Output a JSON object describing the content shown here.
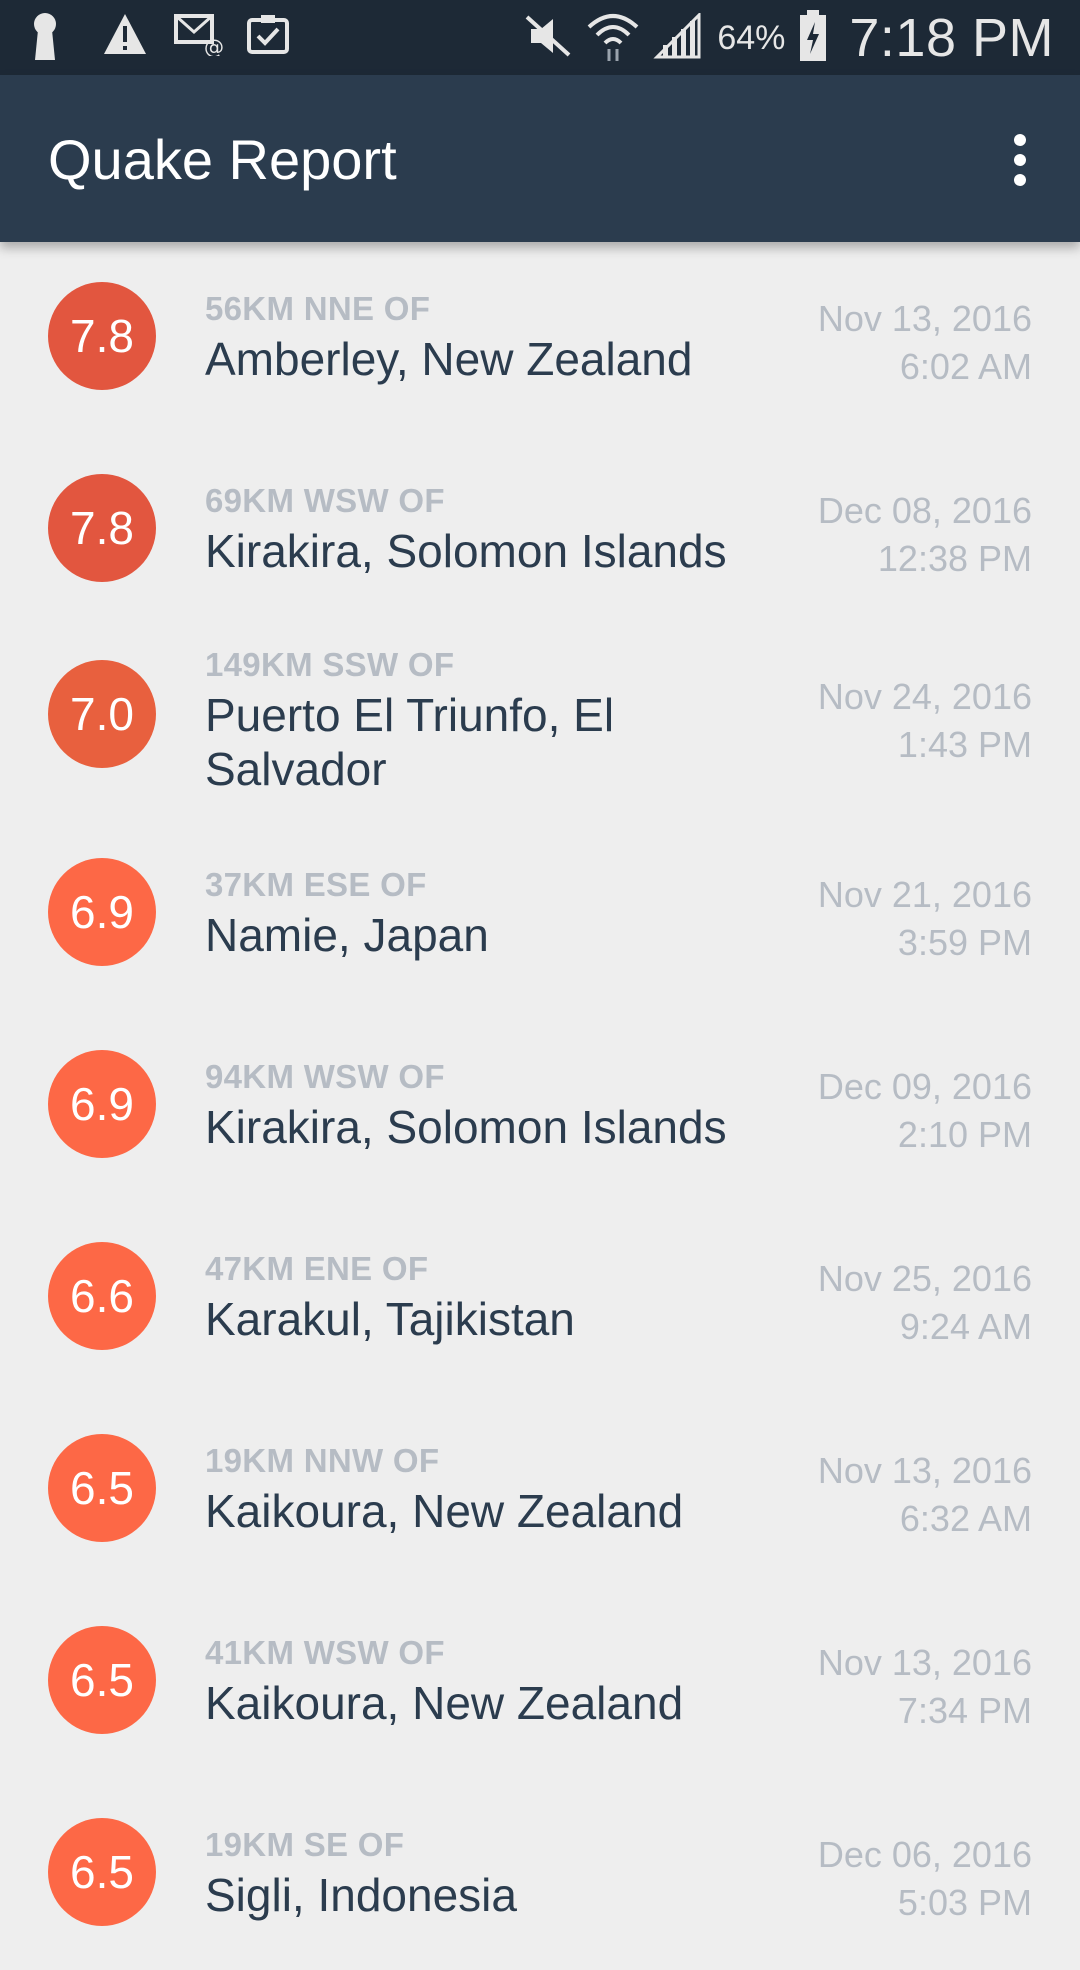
{
  "status_bar": {
    "icons_left": [
      "keyhole-icon",
      "warning-icon",
      "email-icon",
      "clipboard-check-icon"
    ],
    "icons_right": [
      "mute-icon",
      "wifi-icon",
      "signal-icon",
      "battery-charging-icon"
    ],
    "battery": "64%",
    "time": "7:18 PM"
  },
  "app_bar": {
    "title": "Quake Report",
    "menu_icon": "overflow-menu-icon"
  },
  "earthquakes": [
    {
      "mag": "7.8",
      "offset": "56KM NNE OF",
      "location": "Amberley, New Zealand",
      "date": "Nov 13, 2016",
      "time": "6:02 AM",
      "color": "#e2563f"
    },
    {
      "mag": "7.8",
      "offset": "69KM WSW OF",
      "location": "Kirakira, Solomon Islands",
      "date": "Dec 08, 2016",
      "time": "12:38 PM",
      "color": "#e2563f"
    },
    {
      "mag": "7.0",
      "offset": "149KM SSW OF",
      "location": "Puerto El Triunfo, El Salvador",
      "date": "Nov 24, 2016",
      "time": "1:43 PM",
      "color": "#e8603e"
    },
    {
      "mag": "6.9",
      "offset": "37KM ESE OF",
      "location": "Namie, Japan",
      "date": "Nov 21, 2016",
      "time": "3:59 PM",
      "color": "#fd6846"
    },
    {
      "mag": "6.9",
      "offset": "94KM WSW OF",
      "location": "Kirakira, Solomon Islands",
      "date": "Dec 09, 2016",
      "time": "2:10 PM",
      "color": "#fd6846"
    },
    {
      "mag": "6.6",
      "offset": "47KM ENE OF",
      "location": "Karakul, Tajikistan",
      "date": "Nov 25, 2016",
      "time": "9:24 AM",
      "color": "#fd6846"
    },
    {
      "mag": "6.5",
      "offset": "19KM NNW OF",
      "location": "Kaikoura, New Zealand",
      "date": "Nov 13, 2016",
      "time": "6:32 AM",
      "color": "#fd6846"
    },
    {
      "mag": "6.5",
      "offset": "41KM WSW OF",
      "location": "Kaikoura, New Zealand",
      "date": "Nov 13, 2016",
      "time": "7:34 PM",
      "color": "#fd6846"
    },
    {
      "mag": "6.5",
      "offset": "19KM SE OF",
      "location": "Sigli, Indonesia",
      "date": "Dec 06, 2016",
      "time": "5:03 PM",
      "color": "#fd6846"
    }
  ]
}
